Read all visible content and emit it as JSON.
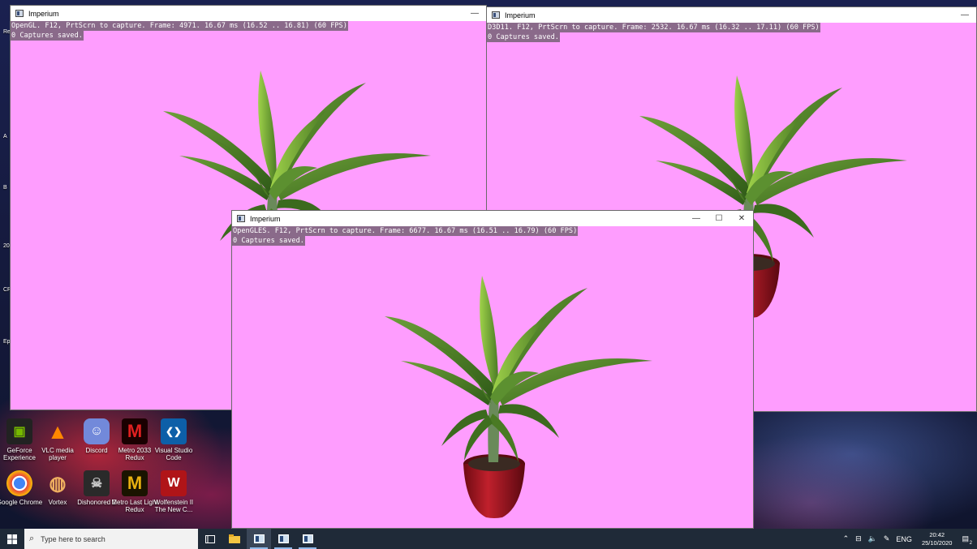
{
  "desktop": {
    "icons": [
      {
        "label": "GeForce Experience",
        "color": "#76b900",
        "glyph": "▣"
      },
      {
        "label": "VLC media player",
        "color": "#ff8800",
        "glyph": "▲"
      },
      {
        "label": "Discord",
        "color": "#7289da",
        "glyph": "☺"
      },
      {
        "label": "Metro 2033 Redux",
        "color": "#b01010",
        "glyph": "M"
      },
      {
        "label": "Visual Studio Code",
        "color": "#1e88e5",
        "glyph": "❮❯"
      },
      {
        "label": "Google Chrome",
        "color": "#e8453c",
        "glyph": "◉"
      },
      {
        "label": "Vortex",
        "color": "#e09a40",
        "glyph": "◍"
      },
      {
        "label": "Dishonored 2",
        "color": "#555555",
        "glyph": "☠"
      },
      {
        "label": "Metro Last Light Redux",
        "color": "#d4a010",
        "glyph": "M"
      },
      {
        "label": "Wolfenstein II The New C...",
        "color": "#c0181c",
        "glyph": "W"
      }
    ],
    "edge_labels": [
      "Re",
      "A",
      "B",
      "20",
      "CR L",
      "Ep L"
    ]
  },
  "windows": {
    "opengl": {
      "title": "Imperium",
      "line1": "OpenGL. F12, PrtScrn to capture. Frame: 4971. 16.67 ms (16.52 .. 16.81) (60 FPS)",
      "line2": "0 Captures saved.",
      "min_icon": "—"
    },
    "d3d11": {
      "title": "Imperium",
      "line1": "D3D11. F12, PrtScrn to capture. Frame: 2532. 16.67 ms (16.32 .. 17.11) (60 FPS)",
      "line2": "0 Captures saved.",
      "min_icon": "—"
    },
    "opengles": {
      "title": "Imperium",
      "line1": "OpenGLES. F12, PrtScrn to capture. Frame: 6677. 16.67 ms (16.51 .. 16.79) (60 FPS)",
      "line2": "0 Captures saved.",
      "min_icon": "—",
      "max_icon": "☐",
      "close_icon": "✕"
    }
  },
  "taskbar": {
    "search_placeholder": "Type here to search",
    "language": "ENG",
    "time": "20:42",
    "date": "25/10/2020",
    "notification_count": "2"
  },
  "colors": {
    "window_background": "#fe9dfe",
    "taskbar": "#1f2a38"
  }
}
